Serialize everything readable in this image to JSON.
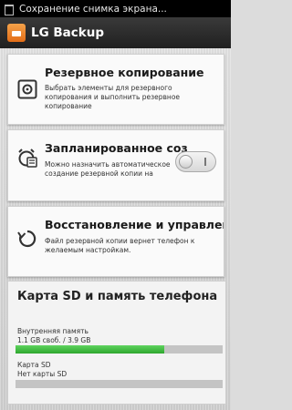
{
  "status_bar": {
    "notification_text": "Сохранение снимка экрана..."
  },
  "app": {
    "title": "LG Backup"
  },
  "cards": [
    {
      "title": "Резервное копирование",
      "description": "Выбрать элементы для резервного копирования и выполнить резервное копирование"
    },
    {
      "title": "Запланированное соз",
      "description": "Можно назначить автоматическое создание резервной копии на",
      "toggle_on": false
    },
    {
      "title": "Восстановление и управление с",
      "description": "Файл резервной копии вернет телефон к желаемым настройкам."
    }
  ],
  "storage": {
    "title": "Карта SD и память телефона",
    "internal_label": "Внутренняя память",
    "internal_value": "1.1 GB своб. / 3.9 GB",
    "internal_used_fraction": 0.72,
    "sd_label": "Карта SD",
    "sd_value": "Нет карты SD"
  }
}
